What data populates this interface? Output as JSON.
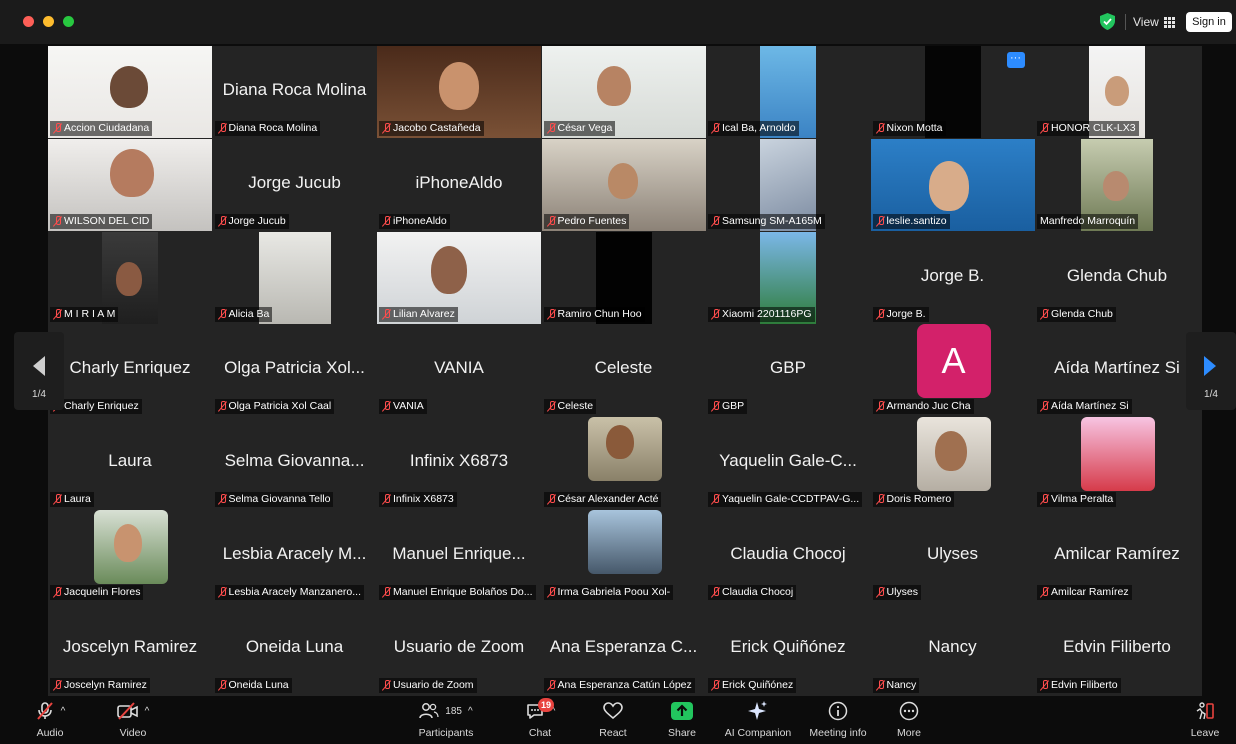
{
  "titlebar": {
    "view_label": "View",
    "signin_label": "Sign in",
    "shield_color": "#22c55e"
  },
  "pagination": {
    "left_page": "1/4",
    "right_page": "1/4"
  },
  "tiles": [
    {
      "label": "Accion Ciudadana",
      "display": "video"
    },
    {
      "label": "Diana Roca Molina",
      "display": "name",
      "big_name": "Diana Roca Molina"
    },
    {
      "label": "Jacobo Castañeda",
      "display": "video",
      "active_speaker": true
    },
    {
      "label": "César Vega",
      "display": "video"
    },
    {
      "label": "Ical Ba, Arnoldo",
      "display": "video"
    },
    {
      "label": "Nixon Motta",
      "display": "video"
    },
    {
      "label": "HONOR CLK-LX3",
      "display": "video"
    },
    {
      "label": "WILSON DEL CID",
      "display": "video"
    },
    {
      "label": "Jorge Jucub",
      "display": "name",
      "big_name": "Jorge Jucub"
    },
    {
      "label": "iPhoneAldo",
      "display": "name",
      "big_name": "iPhoneAldo"
    },
    {
      "label": "Pedro Fuentes",
      "display": "video"
    },
    {
      "label": "Samsung SM-A165M",
      "display": "video"
    },
    {
      "label": "leslie.santizo",
      "display": "video"
    },
    {
      "label": "Manfredo Marroquín",
      "display": "video"
    },
    {
      "label": "M I R I A M",
      "display": "video"
    },
    {
      "label": "Alicia Ba",
      "display": "video"
    },
    {
      "label": "Lilian Alvarez",
      "display": "video"
    },
    {
      "label": "Ramiro Chun Hoo",
      "display": "video"
    },
    {
      "label": "Xiaomi 2201116PG",
      "display": "video"
    },
    {
      "label": "Jorge B.",
      "display": "name",
      "big_name": "Jorge B."
    },
    {
      "label": "Glenda Chub",
      "display": "name",
      "big_name": "Glenda Chub"
    },
    {
      "label": "Charly Enriquez",
      "display": "name",
      "big_name": "Charly Enriquez"
    },
    {
      "label": "Olga Patricia Xol Caal",
      "display": "name",
      "big_name": "Olga Patricia Xol..."
    },
    {
      "label": "VANIA",
      "display": "name",
      "big_name": "VANIA"
    },
    {
      "label": "Celeste",
      "display": "name",
      "big_name": "Celeste"
    },
    {
      "label": "GBP",
      "display": "name",
      "big_name": "GBP"
    },
    {
      "label": "Armando Juc Cha",
      "display": "avatar",
      "avatar_letter": "A",
      "avatar_color": "#d3216a"
    },
    {
      "label": "Aída Martínez Si",
      "display": "name",
      "big_name": "Aída Martínez Si"
    },
    {
      "label": "Laura",
      "display": "name",
      "big_name": "Laura"
    },
    {
      "label": "Selma Giovanna Tello",
      "display": "name",
      "big_name": "Selma Giovanna..."
    },
    {
      "label": "Infinix X6873",
      "display": "name",
      "big_name": "Infinix X6873"
    },
    {
      "label": "César Alexander Acté",
      "display": "photo"
    },
    {
      "label": "Yaquelin Gale-CCDTPAV-G...",
      "display": "name",
      "big_name": "Yaquelin Gale-C..."
    },
    {
      "label": "Doris Romero",
      "display": "photo"
    },
    {
      "label": "Vilma Peralta",
      "display": "photo"
    },
    {
      "label": "Jacquelin Flores",
      "display": "photo"
    },
    {
      "label": "Lesbia Aracely Manzanero...",
      "display": "name",
      "big_name": "Lesbia Aracely M..."
    },
    {
      "label": "Manuel Enrique Bolaños Do...",
      "display": "name",
      "big_name": "Manuel Enrique..."
    },
    {
      "label": "Irma Gabriela Poou Xol-",
      "display": "photo"
    },
    {
      "label": "Claudia Chocoj",
      "display": "name",
      "big_name": "Claudia Chocoj"
    },
    {
      "label": "Ulyses",
      "display": "name",
      "big_name": "Ulyses"
    },
    {
      "label": "Amilcar Ramírez",
      "display": "name",
      "big_name": "Amilcar Ramírez"
    },
    {
      "label": "Joscelyn Ramirez",
      "display": "name",
      "big_name": "Joscelyn Ramirez"
    },
    {
      "label": "Oneida Luna",
      "display": "name",
      "big_name": "Oneida Luna"
    },
    {
      "label": "Usuario de Zoom",
      "display": "name",
      "big_name": "Usuario de Zoom"
    },
    {
      "label": "Ana Esperanza Catún López",
      "display": "name",
      "big_name": "Ana Esperanza C..."
    },
    {
      "label": "Erick Quiñónez",
      "display": "name",
      "big_name": "Erick Quiñónez"
    },
    {
      "label": "Nancy",
      "display": "name",
      "big_name": "Nancy"
    },
    {
      "label": "Edvin Filiberto",
      "display": "name",
      "big_name": "Edvin Filiberto"
    }
  ],
  "toolbar": {
    "audio": "Audio",
    "video": "Video",
    "participants": "Participants",
    "participants_count": "185",
    "chat": "Chat",
    "chat_badge": "19",
    "react": "React",
    "share": "Share",
    "ai_companion": "AI Companion",
    "meeting_info": "Meeting info",
    "more": "More",
    "leave": "Leave",
    "share_color": "#22c55e",
    "leave_color": "#e8433f"
  }
}
